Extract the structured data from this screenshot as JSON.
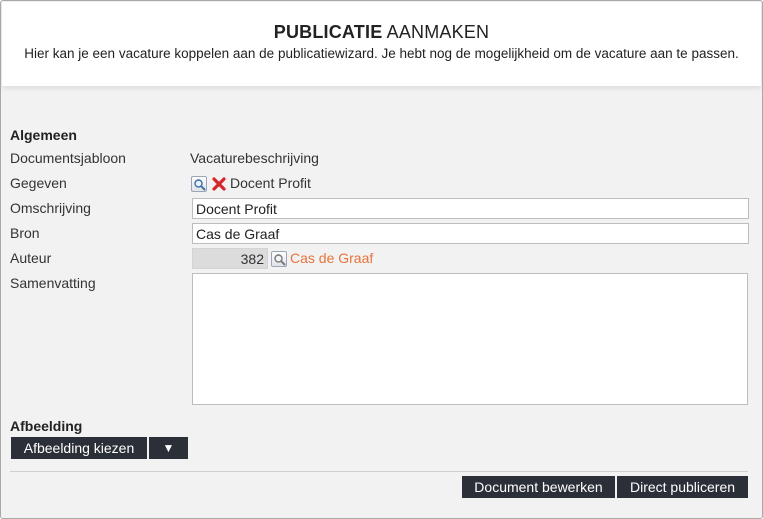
{
  "header": {
    "title_bold": "PUBLICATIE",
    "title_rest": " AANMAKEN",
    "subtitle": "Hier kan je een vacature koppelen aan de publicatiewizard. Je hebt nog de mogelijkheid om de vacature aan te passen."
  },
  "general": {
    "heading": "Algemeen",
    "template_label": "Documentsjabloon",
    "template_value": "Vacaturebeschrijving",
    "data_label": "Gegeven",
    "data_value": "Docent Profit",
    "description_label": "Omschrijving",
    "description_value": "Docent Profit",
    "source_label": "Bron",
    "source_value": "Cas de Graaf",
    "author_label": "Auteur",
    "author_id": "382",
    "author_name": "Cas de Graaf",
    "summary_label": "Samenvatting",
    "summary_value": ""
  },
  "image": {
    "heading": "Afbeelding",
    "choose_label": "Afbeelding kiezen",
    "dropdown_glyph": "▼"
  },
  "footer": {
    "edit_label": "Document bewerken",
    "publish_label": "Direct publiceren"
  },
  "icons": {
    "lookup": "magnifier-icon",
    "delete": "delete-x-icon"
  },
  "colors": {
    "button_bg": "#2b2f38",
    "link": "#e8743b",
    "delete": "#d9242a"
  }
}
